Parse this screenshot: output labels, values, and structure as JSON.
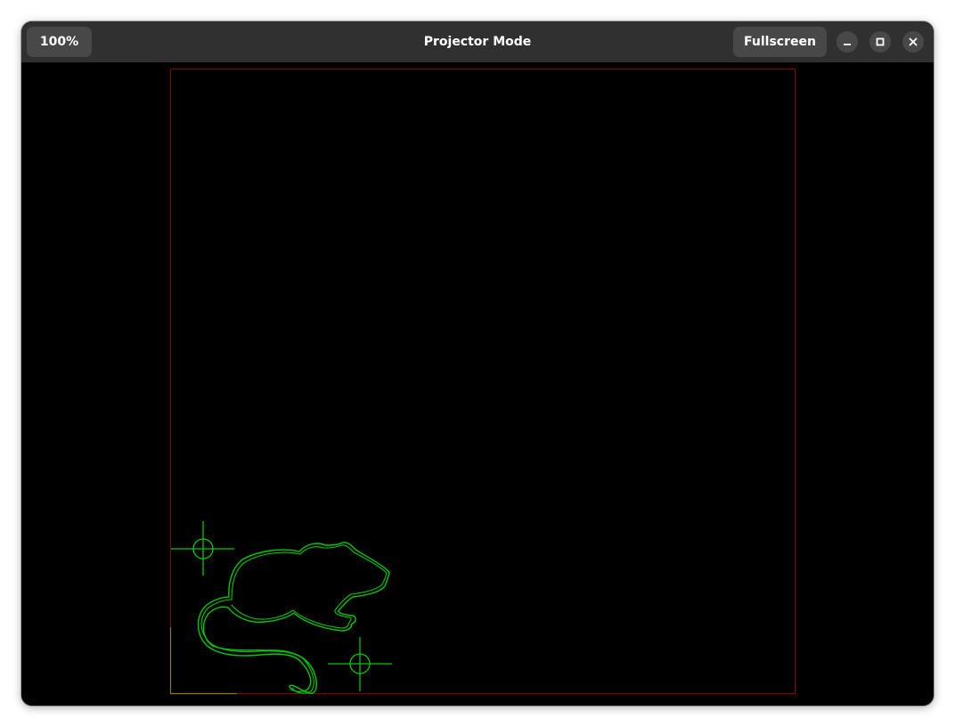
{
  "window": {
    "title": "Projector Mode",
    "zoom_label": "100%",
    "fullscreen_label": "Fullscreen",
    "controls": [
      "minimize-icon",
      "maximize-icon",
      "close-icon"
    ]
  },
  "canvas": {
    "background": "#000000",
    "projection_border_color": "#8b0000",
    "origin_marker_color": "#8b7a1a",
    "pattern_color": "#00c800",
    "content": [
      "rat-outline",
      "registration-crosshair",
      "registration-crosshair"
    ]
  }
}
